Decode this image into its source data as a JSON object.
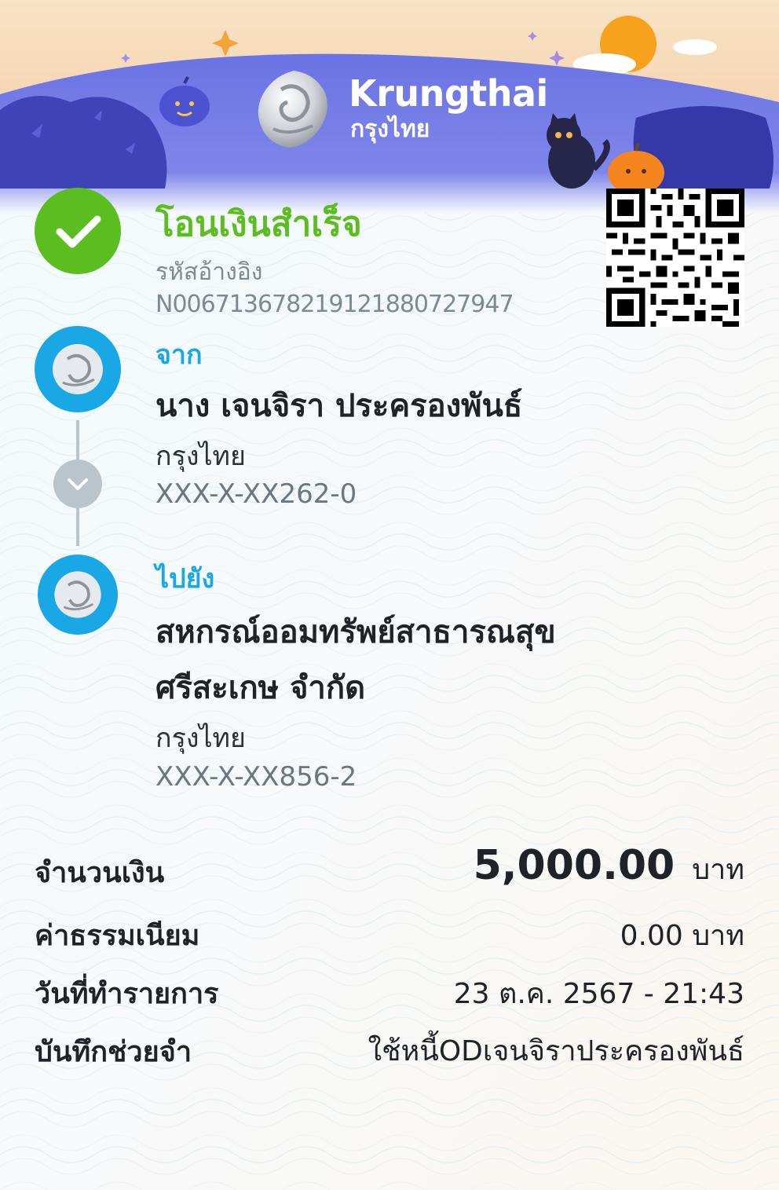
{
  "header": {
    "brand_name": "Krungthai",
    "brand_name_thai": "กรุงไทย"
  },
  "status": {
    "title": "โอนเงินสำเร็จ",
    "ref_label": "รหัสอ้างอิง",
    "ref_value": "N006713678219121880727947"
  },
  "from": {
    "label": "จาก",
    "name": "นาง เจนจิรา ประครองพันธ์",
    "bank": "กรุงไทย",
    "account": "XXX-X-XX262-0"
  },
  "to": {
    "label": "ไปยัง",
    "name_line1": "สหกรณ์ออมทรัพย์สาธารณสุข",
    "name_line2": "ศรีสะเกษ จำกัด",
    "bank": "กรุงไทย",
    "account": "XXX-X-XX856-2"
  },
  "details": {
    "amount_label": "จำนวนเงิน",
    "amount_value": "5,000.00",
    "amount_unit": "บาท",
    "fee_label": "ค่าธรรมเนียม",
    "fee_value": "0.00 บาท",
    "date_label": "วันที่ทำรายการ",
    "date_value": "23 ต.ค. 2567 - 21:43",
    "memo_label": "บันทึกช่วยจำ",
    "memo_value": "ใช้หนี้ODเจนจิราประครองพันธ์"
  },
  "colors": {
    "success": "#5cbd21",
    "brand_blue": "#1aa7e6",
    "banner_purple": "#5b62d6"
  },
  "icons": {
    "status": "check-circle-icon",
    "bank_logo": "krungthai-logo-icon",
    "connector": "chevron-down-icon",
    "qr": "qr-code-icon"
  }
}
